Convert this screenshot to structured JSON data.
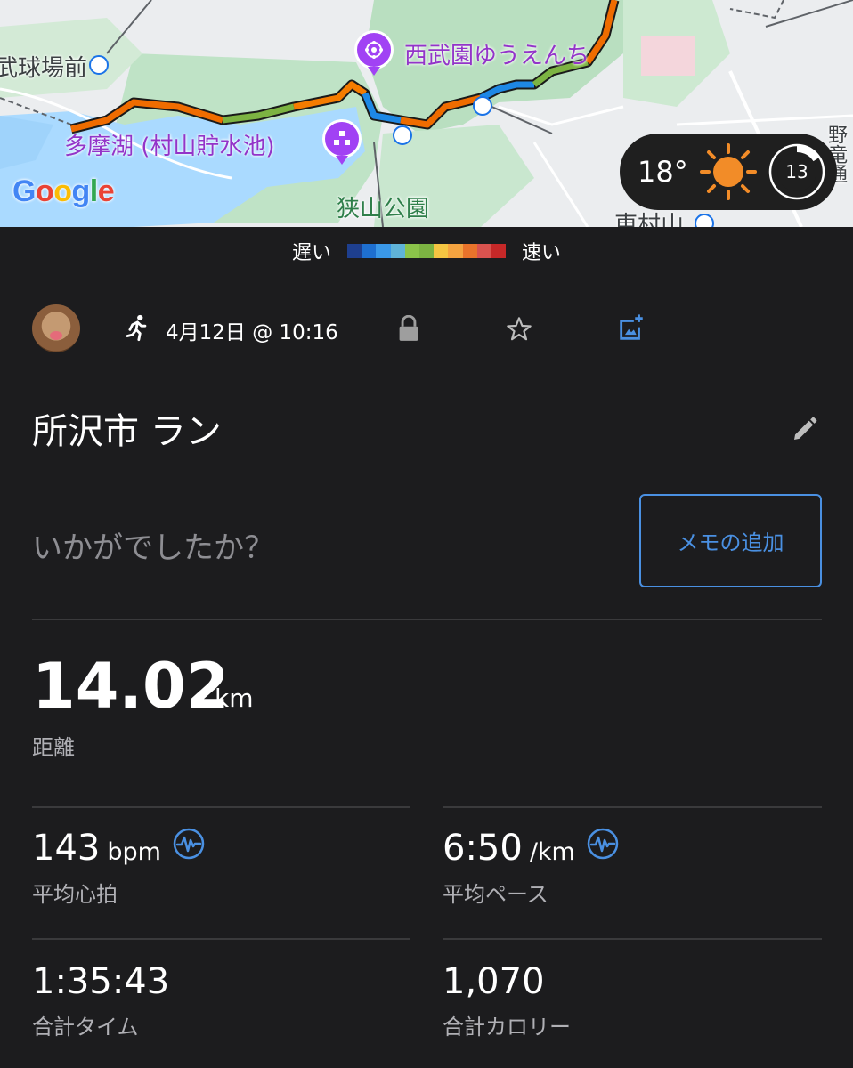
{
  "map": {
    "labels": {
      "seibuen": "西武園ゆうえんち",
      "tamako": "多摩湖 (村山貯水池)",
      "sayama_park": "狭山公園",
      "stadium_front": "武球場前",
      "higashimurayama": "東村山",
      "road_side": "野竜通"
    },
    "google_logo": [
      "G",
      "o",
      "o",
      "g",
      "l",
      "e"
    ],
    "google_colors": [
      "#4285f4",
      "#ea4335",
      "#fbbc05",
      "#4285f4",
      "#34a853",
      "#ea4335"
    ],
    "route_colors": [
      "#d93025",
      "#ef6c00",
      "#f9a825",
      "#7cb342",
      "#1e88e5"
    ]
  },
  "weather": {
    "temperature": "18°",
    "icon": "sun-icon",
    "timer_value": "13"
  },
  "legend": {
    "slow_label": "遅い",
    "fast_label": "速い",
    "colors": [
      "#1e3f8f",
      "#1e6fd0",
      "#3a98e8",
      "#5fb3d8",
      "#8bc34a",
      "#7cb342",
      "#f4c542",
      "#f4a340",
      "#e9732b",
      "#d9534f",
      "#c62828"
    ]
  },
  "activity": {
    "type_icon": "runner-icon",
    "date": "4月12日 @ 10:16",
    "title": "所沢市 ラン",
    "note_prompt": "いかがでしたか？",
    "add_memo_label": "メモの追加"
  },
  "stats": {
    "distance": {
      "value": "14.02",
      "unit": "km",
      "label": "距離"
    },
    "avg_hr": {
      "value": "143",
      "unit": "bpm",
      "label": "平均心拍"
    },
    "avg_pace": {
      "value": "6:50",
      "unit": "/km",
      "label": "平均ペース"
    },
    "total_time": {
      "value": "1:35:43",
      "label": "合計タイム"
    },
    "total_calories": {
      "value": "1,070",
      "label": "合計カロリー"
    }
  },
  "colors": {
    "background": "#1c1c1e",
    "accent_blue": "#4a90e2",
    "secondary_text": "#b0b0b5",
    "divider": "#3a3a3c"
  }
}
